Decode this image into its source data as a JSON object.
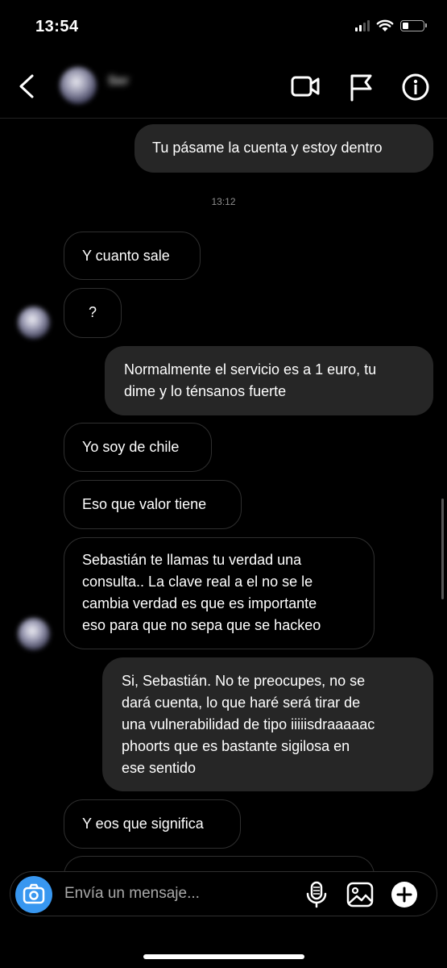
{
  "status_bar": {
    "time": "13:54",
    "battery_level": 0.3
  },
  "header": {
    "contact_name": "Ser"
  },
  "timestamp": "13:12",
  "messages": {
    "m1": "Tu pásame la cuenta y estoy dentro",
    "m2": "Y cuanto sale",
    "m3": "?",
    "m4a": "Normalmente el servicio es a 1 euro, tu",
    "m4b": "dime y lo ténsanos fuerte",
    "m5": "Yo soy de chile",
    "m6": "Eso que valor tiene",
    "m7a": "Sebastián te llamas tu verdad una",
    "m7b": "consulta.. La clave real a el no se le",
    "m7c": "cambia verdad es que es importante",
    "m7d": "eso para que no sepa que se hackeo",
    "m8a": "Si, Sebastián. No te preocupes, no se",
    "m8b": "dará cuenta, lo que haré será tirar de",
    "m8c": "una vulnerabilidad de tipo iiiiisdraaaaac",
    "m8d": "phoorts que es bastante sigilosa en",
    "m8e": "ese sentido",
    "m9": "Y eos que significa"
  },
  "composer": {
    "placeholder": "Envía un mensaje..."
  },
  "colors": {
    "accent": "#3897f0",
    "outgoing_bubble": "#262626",
    "incoming_border": "#2f2f2f"
  }
}
